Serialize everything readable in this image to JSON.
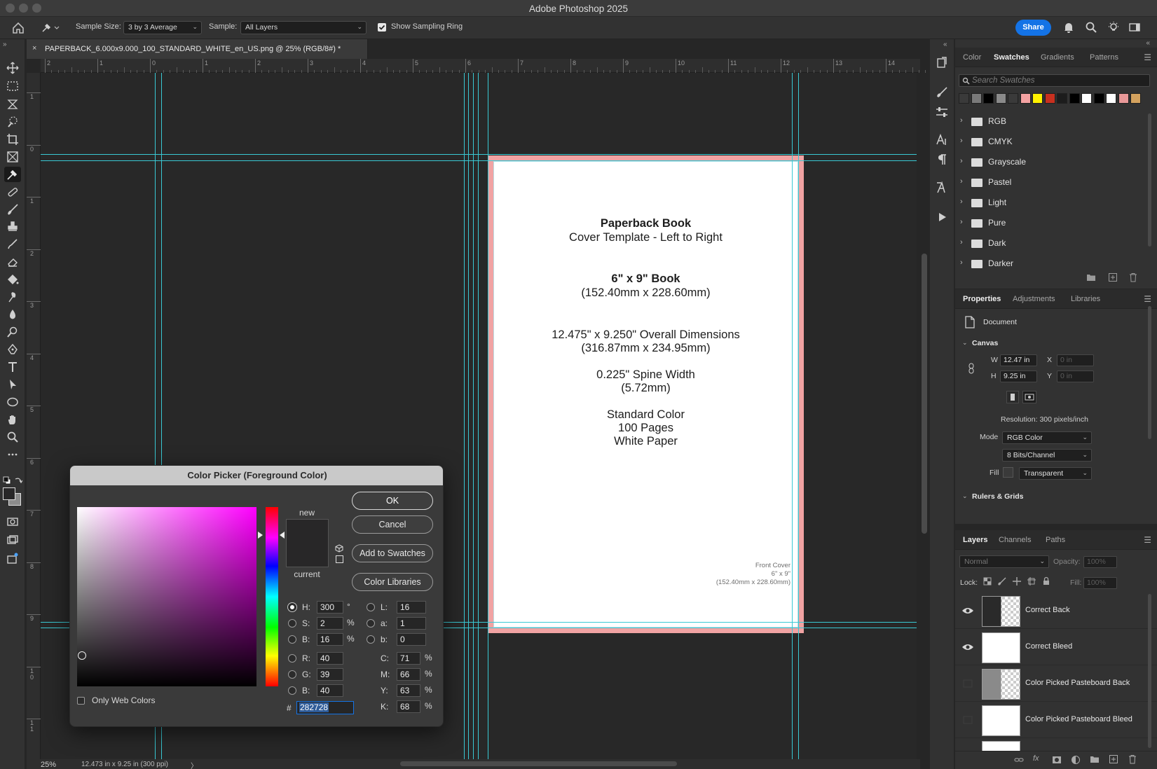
{
  "app": {
    "title": "Adobe Photoshop 2025",
    "share_label": "Share"
  },
  "options_bar": {
    "sample_size_label": "Sample Size:",
    "sample_size_value": "3 by 3 Average",
    "sample_label": "Sample:",
    "sample_value": "All Layers",
    "show_ring_label": "Show Sampling Ring",
    "show_ring_checked": true
  },
  "document": {
    "tab_title": "PAPERBACK_6.000x9.000_100_STANDARD_WHITE_en_US.png @ 25% (RGB/8#) *",
    "close_glyph": "×",
    "ruler_h": [
      "2",
      "1",
      "0",
      "1",
      "2",
      "3",
      "4",
      "5",
      "6",
      "7",
      "8",
      "9",
      "10",
      "11",
      "12",
      "13",
      "14"
    ],
    "ruler_v": [
      "1",
      "0",
      "1",
      "2",
      "3",
      "4",
      "5",
      "6",
      "7",
      "8",
      "9",
      "1\n0",
      "1\n1"
    ],
    "page_text": {
      "title": "Paperback Book",
      "subtitle": "Cover Template - Left to Right",
      "size": "6\" x 9\" Book",
      "size_mm": "(152.40mm x 228.60mm)",
      "overall": "12.475\" x 9.250\" Overall Dimensions",
      "overall_mm": "(316.87mm x 234.95mm)",
      "spine": "0.225\" Spine Width",
      "spine_mm": "(5.72mm)",
      "color": "Standard Color",
      "pages": "100 Pages",
      "paper": "White Paper",
      "front_cover": "Front Cover",
      "front_size": "6\" x 9\"",
      "front_mm": "(152.40mm x 228.60mm)"
    }
  },
  "status": {
    "zoom": "25%",
    "doc_info": "12.473 in x 9.25 in (300 ppi)",
    "arrow": "〉"
  },
  "color_picker": {
    "title": "Color Picker (Foreground Color)",
    "new_label": "new",
    "current_label": "current",
    "ok_label": "OK",
    "cancel_label": "Cancel",
    "add_swatches_label": "Add to Swatches",
    "color_libraries_label": "Color Libraries",
    "only_web_label": "Only Web Colors",
    "hue_color": "#ff00ff",
    "new_color": "#282728",
    "current_color": "#282728",
    "fields": {
      "H": "300",
      "S": "2",
      "Bv": "16",
      "R": "40",
      "G": "39",
      "B": "40",
      "L": "16",
      "a": "1",
      "b": "0",
      "C": "71",
      "M": "66",
      "Y": "63",
      "K": "68"
    },
    "labels": {
      "H": "H:",
      "S": "S:",
      "Bv": "B:",
      "R": "R:",
      "G": "G:",
      "B": "B:",
      "L": "L:",
      "a": "a:",
      "b": "b:",
      "C": "C:",
      "M": "M:",
      "Y": "Y:",
      "K": "K:",
      "deg": "°",
      "pct": "%",
      "hash": "#"
    },
    "hex": "282728"
  },
  "swatches_panel": {
    "tabs": [
      "Color",
      "Swatches",
      "Gradients",
      "Patterns"
    ],
    "active_tab": "Swatches",
    "search_placeholder": "Search Swatches",
    "swatch_colors": [
      "#3a3a3a",
      "#7a7a7a",
      "#000000",
      "#8a8a8a",
      "#3a3a3a",
      "#f4a2a2",
      "#fff200",
      "#c8301f",
      "#1c1c1c",
      "#000000",
      "#ffffff",
      "#000000",
      "#ffffff",
      "#e89898",
      "#d4a25e"
    ],
    "folders": [
      "RGB",
      "CMYK",
      "Grayscale",
      "Pastel",
      "Light",
      "Pure",
      "Dark",
      "Darker"
    ]
  },
  "properties_panel": {
    "tabs": [
      "Properties",
      "Adjustments",
      "Libraries"
    ],
    "doc_label": "Document",
    "canvas_section": "Canvas",
    "w_label": "W",
    "w_value": "12.47 in",
    "h_label": "H",
    "h_value": "9.25 in",
    "x_label": "X",
    "x_value": "0 in",
    "y_label": "Y",
    "y_value": "0 in",
    "resolution": "Resolution: 300 pixels/inch",
    "mode_label": "Mode",
    "mode_value": "RGB Color",
    "depth_value": "8 Bits/Channel",
    "fill_label": "Fill",
    "fill_value": "Transparent",
    "rulers_section": "Rulers & Grids"
  },
  "layers_panel": {
    "tabs": [
      "Layers",
      "Channels",
      "Paths"
    ],
    "blend_mode": "Normal",
    "opacity_label": "Opacity:",
    "opacity_value": "100%",
    "lock_label": "Lock:",
    "fill_label": "Fill:",
    "fill_value": "100%",
    "layers": [
      {
        "name": "Correct Back",
        "visible": true
      },
      {
        "name": "Correct Bleed",
        "visible": true
      },
      {
        "name": "Color Picked Pasteboard Back",
        "visible": false
      },
      {
        "name": "Color Picked Pasteboard Bleed",
        "visible": false
      }
    ]
  }
}
